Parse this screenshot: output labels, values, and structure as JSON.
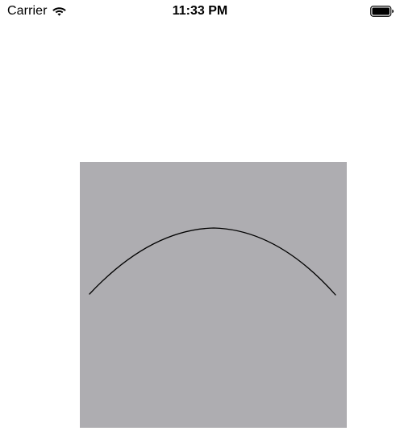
{
  "status_bar": {
    "carrier": "Carrier",
    "time": "11:33 PM",
    "wifi_icon": "wifi-icon",
    "battery_icon": "battery-full-icon"
  },
  "canvas": {
    "background_color": "#aeadb1",
    "stroke_color": "#000000",
    "shape": "arc-curve"
  }
}
